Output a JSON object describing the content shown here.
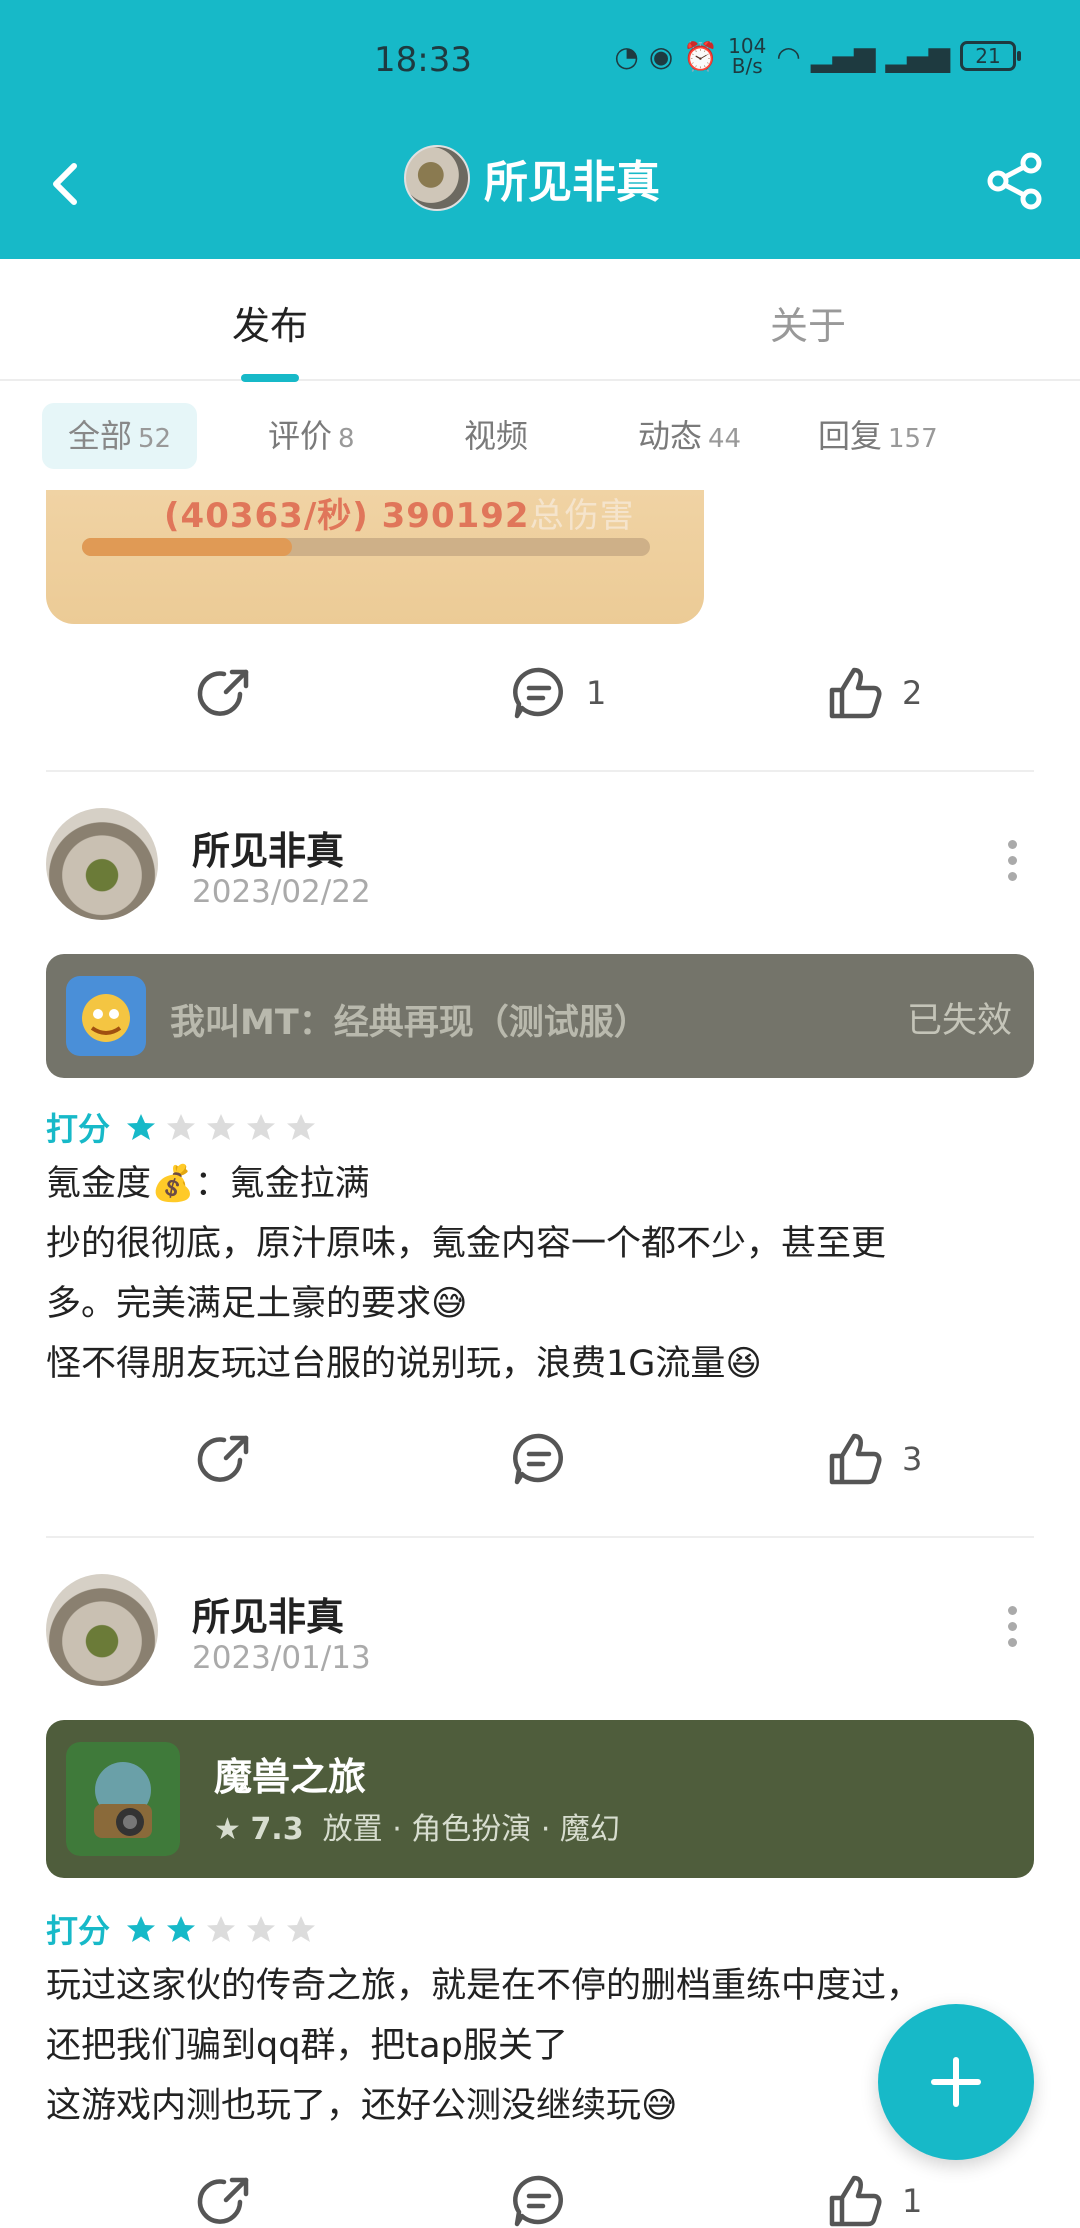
{
  "status_bar": {
    "time": "18:33",
    "network_speed_top": "104",
    "network_speed_bottom": "B/s",
    "battery": "21"
  },
  "header": {
    "title": "所见非真"
  },
  "tabs": [
    {
      "label": "发布"
    },
    {
      "label": "关于"
    }
  ],
  "filters": [
    {
      "label": "全部",
      "count": "52"
    },
    {
      "label": "评价",
      "count": "8"
    },
    {
      "label": "视频",
      "count": ""
    },
    {
      "label": "动态",
      "count": "44"
    },
    {
      "label": "回复",
      "count": "157"
    }
  ],
  "partial_post": {
    "image_text": {
      "damage_rate": "(40363/秒)",
      "damage_total": "390192",
      "damage_label": "总伤害"
    },
    "comment_count": "1",
    "like_count": "2"
  },
  "posts": [
    {
      "author": "所见非真",
      "date": "2023/02/22",
      "game": {
        "name": "我叫MT：经典再现（测试服）",
        "status": "已失效"
      },
      "rating_label": "打分",
      "rating": 1,
      "lines": [
        "氪金度💰：氪金拉满",
        "抄的很彻底，原汁原味，氪金内容一个都不少，甚至更",
        "多。完美满足土豪的要求😅",
        "怪不得朋友玩过台服的说别玩，浪费1G流量😆"
      ],
      "comment_count": "",
      "like_count": "3"
    },
    {
      "author": "所见非真",
      "date": "2023/01/13",
      "game": {
        "name": "魔兽之旅",
        "score": "7.3",
        "tags": "放置 · 角色扮演 · 魔幻"
      },
      "rating_label": "打分",
      "rating": 2,
      "lines": [
        "玩过这家伙的传奇之旅，就是在不停的删档重练中度过，",
        "还把我们骗到qq群，把tap服关了",
        "这游戏内测也玩了，还好公测没继续玩😅"
      ],
      "comment_count": "",
      "like_count": "1"
    }
  ],
  "colors": {
    "accent": "#17b9c8",
    "invalid_card": "#74746a",
    "game_card": "#4f5d3c"
  }
}
